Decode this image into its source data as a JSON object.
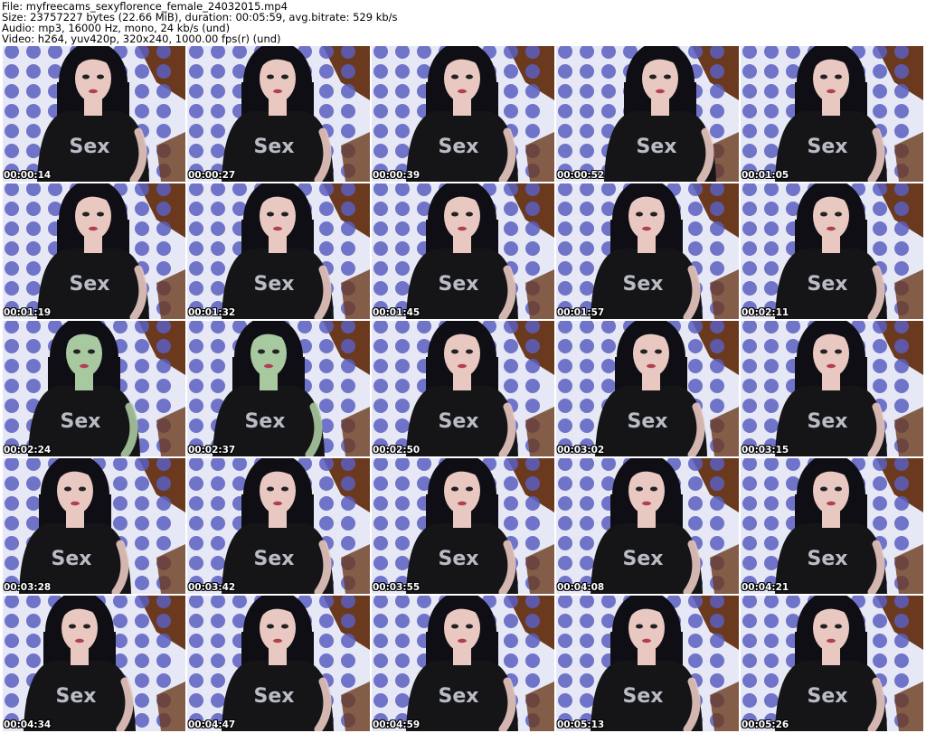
{
  "header": {
    "file": "File: myfreecams_sexyflorence_female_24032015.mp4",
    "size": "Size: 23757227 bytes (22.66 MiB), duration: 00:05:59, avg.bitrate: 529 kb/s",
    "audio": "Audio: mp3, 16000 Hz, mono, 24 kb/s (und)",
    "video": "Video: h264, yuv420p, 320x240, 1000.00 fps(r) (und)"
  },
  "shirt_text": "Sex",
  "thumbnails": [
    {
      "time": "00:00:14"
    },
    {
      "time": "00:00:27"
    },
    {
      "time": "00:00:39"
    },
    {
      "time": "00:00:52"
    },
    {
      "time": "00:01:05"
    },
    {
      "time": "00:01:19"
    },
    {
      "time": "00:01:32"
    },
    {
      "time": "00:01:45"
    },
    {
      "time": "00:01:57"
    },
    {
      "time": "00:02:11"
    },
    {
      "time": "00:02:24"
    },
    {
      "time": "00:02:37"
    },
    {
      "time": "00:02:50"
    },
    {
      "time": "00:03:02"
    },
    {
      "time": "00:03:15"
    },
    {
      "time": "00:03:28"
    },
    {
      "time": "00:03:42"
    },
    {
      "time": "00:03:55"
    },
    {
      "time": "00:04:08"
    },
    {
      "time": "00:04:21"
    },
    {
      "time": "00:04:34"
    },
    {
      "time": "00:04:47"
    },
    {
      "time": "00:04:59"
    },
    {
      "time": "00:05:13"
    },
    {
      "time": "00:05:26"
    }
  ],
  "colors": {
    "bedding": "#5a5fc0",
    "bedding_light": "#e6e8f6",
    "wall": "#6b3a1e",
    "shirt": "#151518",
    "hair": "#0e0e14",
    "skin": "#e8c8c0",
    "skin_green": "#a8c8a0",
    "print": "#b9bcc4"
  }
}
